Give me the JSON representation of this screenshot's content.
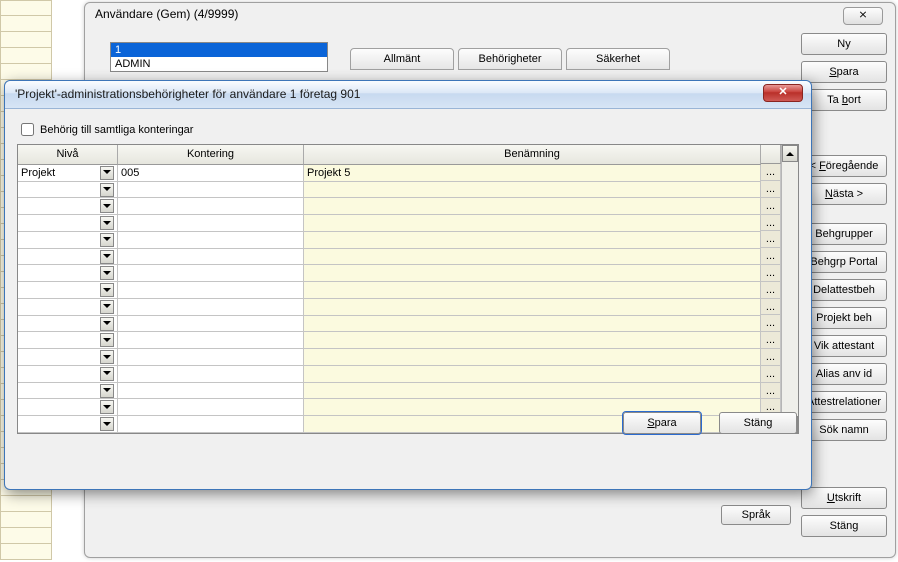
{
  "main_window": {
    "title": "Användare (Gem) (4/9999)",
    "sys_close": "✕",
    "user_list": {
      "selected": "1",
      "row2": "ADMIN"
    },
    "tabs": {
      "allmant": "Allmänt",
      "behorigheter": "Behörigheter",
      "sakerhet": "Säkerhet"
    },
    "sprak": "Språk"
  },
  "right_buttons": {
    "ny": "Ny",
    "spara": "Spara",
    "ta_bort": "Ta bort",
    "foregaende": "< Föregående",
    "nasta": "Nästa >",
    "behgrupper": "Behgrupper",
    "behgrp_portal": "Behgrp Portal",
    "delattestbeh": "Delattestbeh",
    "projekt_beh": "Projekt beh",
    "vik_attestant": "Vik attestant",
    "alias_anv_id": "Alias anv id",
    "attestrelationer": "Attestrelationer",
    "sok_namn": "Sök namn",
    "utskrift": "Utskrift",
    "stang": "Stäng"
  },
  "dialog": {
    "title": "'Projekt'-administrationsbehörigheter för användare 1 företag 901",
    "close": "✕",
    "checkbox_label": "Behörig till samtliga konteringar",
    "headers": {
      "niva": "Nivå",
      "kontering": "Kontering",
      "benamning": "Benämning"
    },
    "rows": [
      {
        "niva": "Projekt",
        "kontering": "005",
        "benamning": "Projekt 5"
      }
    ],
    "ellipsis": "...",
    "save": "Spara",
    "close_btn": "Stäng"
  }
}
